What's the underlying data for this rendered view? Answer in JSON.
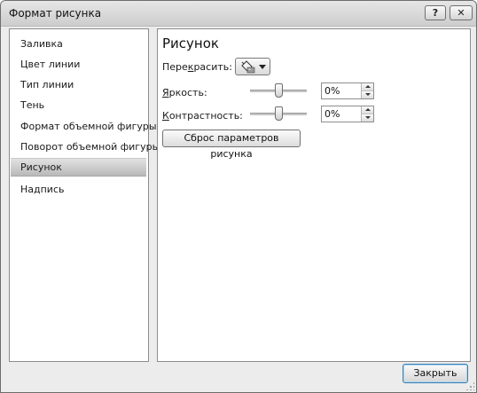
{
  "window": {
    "title": "Формат рисунка",
    "help_label": "?",
    "close_label": "✕"
  },
  "sidebar": {
    "items": [
      {
        "label": "Заливка",
        "selected": false
      },
      {
        "label": "Цвет линии",
        "selected": false
      },
      {
        "label": "Тип линии",
        "selected": false
      },
      {
        "label": "Тень",
        "selected": false
      },
      {
        "label": "Формат объемной фигуры",
        "selected": false
      },
      {
        "label": "Поворот объемной фигуры",
        "selected": false
      },
      {
        "label": "Рисунок",
        "selected": true
      },
      {
        "label": "Надпись",
        "selected": false
      }
    ]
  },
  "panel": {
    "title": "Рисунок",
    "recolor": {
      "label_pre": "Пере",
      "label_access": "к",
      "label_post": "расить:",
      "icon": "paint-bucket-icon"
    },
    "brightness": {
      "label_access": "Я",
      "label_post": "ркость:",
      "value": "0%",
      "slider_level": 0.5
    },
    "contrast": {
      "label_access": "К",
      "label_post": "онтрастность:",
      "value": "0%",
      "slider_level": 0.5
    },
    "reset_label": "Сброс параметров рисунка"
  },
  "footer": {
    "close_button": "Закрыть"
  }
}
